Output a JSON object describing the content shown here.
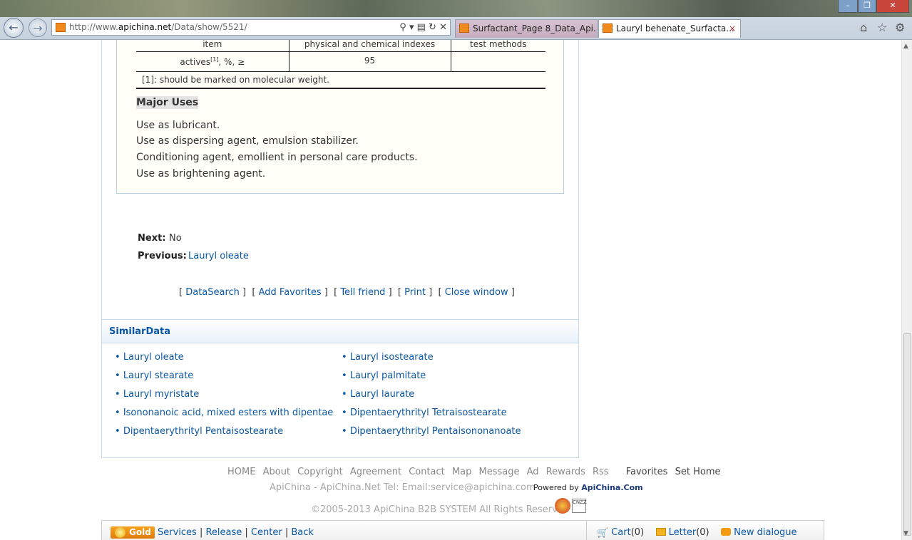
{
  "browser": {
    "url_prefix": "http://www.",
    "url_domain": "apichina.net",
    "url_path": "/Data/show/5521/",
    "tabs": [
      {
        "label": "Surfactant_Page 8_Data_Api..."
      },
      {
        "label": "Lauryl behenate_Surfacta..."
      }
    ],
    "tab_close": "×"
  },
  "spec_table": {
    "headers": [
      "item",
      "physical and chemical indexes",
      "test methods"
    ],
    "row": {
      "item": "actives",
      "sup": "[1]",
      "item_suffix": ", %, ≥",
      "value": "95",
      "method": ""
    },
    "note": "[1]: should be marked on molecular weight."
  },
  "major_uses": {
    "title": "Major Uses",
    "items": [
      "Use as lubricant.",
      "Use as dispersing agent, emulsion stabilizer.",
      "Conditioning agent, emollient in personal care products.",
      "Use as brightening agent."
    ]
  },
  "navigation": {
    "next_label": "Next:",
    "next_value": "No",
    "previous_label": "Previous:",
    "previous_value": "Lauryl oleate"
  },
  "actions": [
    "DataSearch",
    "Add Favorites",
    "Tell friend",
    "Print",
    "Close window"
  ],
  "similar": {
    "title": "SimilarData",
    "left": [
      "Lauryl oleate",
      "Lauryl stearate",
      "Lauryl myristate",
      "Isononanoic acid, mixed esters with dipentae",
      "Dipentaerythrityl Pentaisostearate"
    ],
    "right": [
      "Lauryl isostearate",
      "Lauryl palmitate",
      "Lauryl laurate",
      "Dipentaerythrityl Tetraisostearate",
      "Dipentaerythrityl Pentaisononanoate"
    ]
  },
  "footer": {
    "links": [
      "HOME",
      "About",
      "Copyright",
      "Agreement",
      "Contact",
      "Map",
      "Message",
      "Ad",
      "Rewards",
      "Rss"
    ],
    "favorites": "Favorites",
    "set_home": "Set Home",
    "contact_line": "ApiChina - ApiChina.Net Tel:   Email:service@apichina.com",
    "powered_prefix": "Powered by ",
    "powered_brand": "ApiChina.Com",
    "copyright": "©2005-2013 ApiChina B2B SYSTEM All Rights Reserved",
    "cnzz": "CNZZ"
  },
  "bottom_bar": {
    "gold": "Gold",
    "links": [
      "Services",
      "Release",
      "Center",
      "Back"
    ],
    "cart_label": "Cart",
    "cart_count": "(0)",
    "letter_label": "Letter",
    "letter_count": "(0)",
    "dialogue": "New dialogue"
  },
  "colors": {
    "link": "#0b57a4",
    "gold": "#f39c12"
  }
}
